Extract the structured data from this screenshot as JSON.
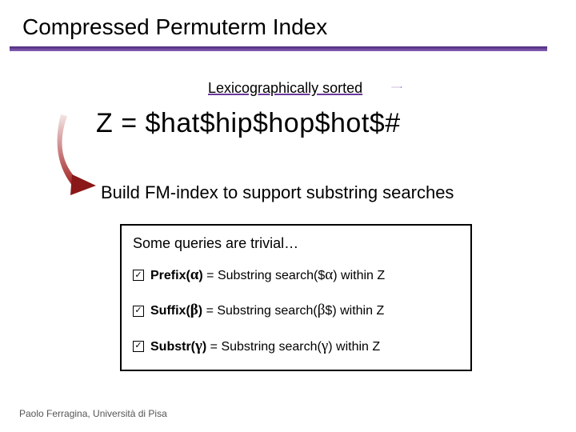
{
  "title": "Compressed Permuterm Index",
  "lex_label": "Lexicographically sorted",
  "z_expr": "Z = $hat$hip$hop$hot$#",
  "build_line": "Build FM-index to support substring searches",
  "box": {
    "title": "Some queries are trivial…",
    "items": [
      {
        "name_html": "Prefix(α)",
        "rest_html": " = Substring search($α) within Z"
      },
      {
        "name_html": "Suffix(β)",
        "rest_html": " = Substring search(β$) within Z"
      },
      {
        "name_html": "Substr(γ)",
        "rest_html": " = Substring search(γ) within Z"
      }
    ]
  },
  "footer": "Paolo Ferragina, Università di Pisa"
}
